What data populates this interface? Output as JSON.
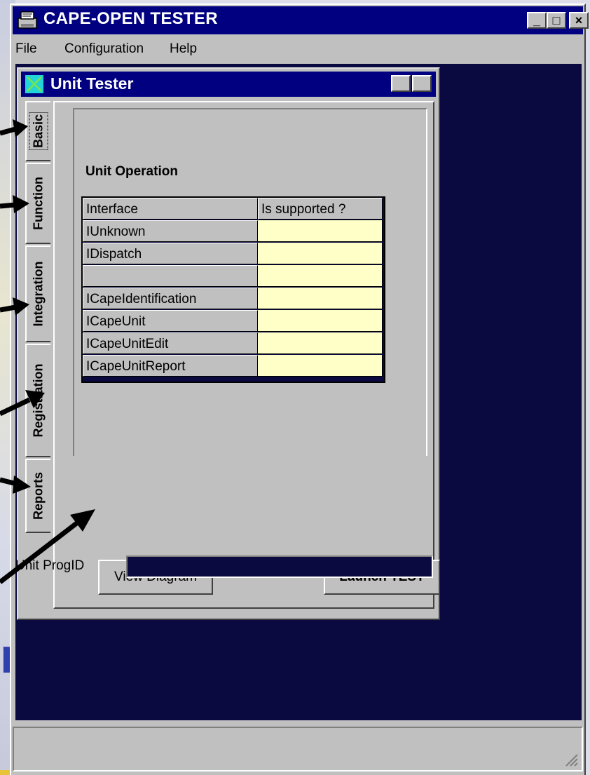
{
  "app": {
    "title": "CAPE-OPEN TESTER",
    "icon": "printer-icon",
    "buttons": {
      "minimize": "_",
      "maximize": "□",
      "close": "×"
    }
  },
  "menu": {
    "items": [
      {
        "label": "File"
      },
      {
        "label": "Configuration"
      },
      {
        "label": "Help"
      }
    ]
  },
  "child_window": {
    "title": "Unit Tester",
    "buttons": {
      "view_diagram": "View Diagram",
      "launch_test": "Launch TEST"
    },
    "tabs": [
      {
        "label": "Basic",
        "active": true
      },
      {
        "label": "Function",
        "active": false
      },
      {
        "label": "Integration",
        "active": false
      },
      {
        "label": "Registration",
        "active": false
      },
      {
        "label": "Reports",
        "active": false
      }
    ],
    "section_title": "Unit Operation",
    "grid": {
      "headers": [
        "Interface",
        "Is supported ?"
      ],
      "rows": [
        [
          "IUnknown",
          ""
        ],
        [
          "IDispatch",
          ""
        ],
        [
          "",
          ""
        ],
        [
          "ICapeIdentification",
          ""
        ],
        [
          "ICapeUnit",
          ""
        ],
        [
          "ICapeUnitEdit",
          ""
        ],
        [
          "ICapeUnitReport",
          ""
        ]
      ]
    },
    "progid_label": "Unit ProgID",
    "progid_value": ""
  },
  "colors": {
    "title_bar": "#000080",
    "mdi_background": "#0a0a40",
    "supported_cell": "#ffffc8",
    "window_face": "#c0c0c0"
  }
}
